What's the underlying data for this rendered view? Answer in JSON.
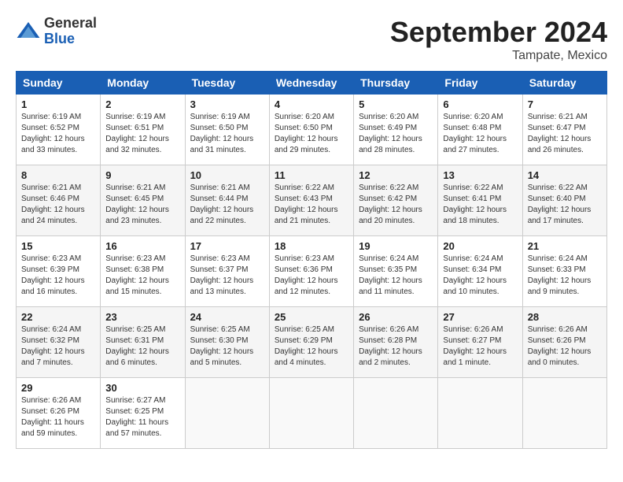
{
  "header": {
    "logo": {
      "line1": "General",
      "line2": "Blue"
    },
    "title": "September 2024",
    "location": "Tampate, Mexico"
  },
  "weekdays": [
    "Sunday",
    "Monday",
    "Tuesday",
    "Wednesday",
    "Thursday",
    "Friday",
    "Saturday"
  ],
  "weeks": [
    [
      {
        "day": "1",
        "sunrise": "Sunrise: 6:19 AM",
        "sunset": "Sunset: 6:52 PM",
        "daylight": "Daylight: 12 hours and 33 minutes."
      },
      {
        "day": "2",
        "sunrise": "Sunrise: 6:19 AM",
        "sunset": "Sunset: 6:51 PM",
        "daylight": "Daylight: 12 hours and 32 minutes."
      },
      {
        "day": "3",
        "sunrise": "Sunrise: 6:19 AM",
        "sunset": "Sunset: 6:50 PM",
        "daylight": "Daylight: 12 hours and 31 minutes."
      },
      {
        "day": "4",
        "sunrise": "Sunrise: 6:20 AM",
        "sunset": "Sunset: 6:50 PM",
        "daylight": "Daylight: 12 hours and 29 minutes."
      },
      {
        "day": "5",
        "sunrise": "Sunrise: 6:20 AM",
        "sunset": "Sunset: 6:49 PM",
        "daylight": "Daylight: 12 hours and 28 minutes."
      },
      {
        "day": "6",
        "sunrise": "Sunrise: 6:20 AM",
        "sunset": "Sunset: 6:48 PM",
        "daylight": "Daylight: 12 hours and 27 minutes."
      },
      {
        "day": "7",
        "sunrise": "Sunrise: 6:21 AM",
        "sunset": "Sunset: 6:47 PM",
        "daylight": "Daylight: 12 hours and 26 minutes."
      }
    ],
    [
      {
        "day": "8",
        "sunrise": "Sunrise: 6:21 AM",
        "sunset": "Sunset: 6:46 PM",
        "daylight": "Daylight: 12 hours and 24 minutes."
      },
      {
        "day": "9",
        "sunrise": "Sunrise: 6:21 AM",
        "sunset": "Sunset: 6:45 PM",
        "daylight": "Daylight: 12 hours and 23 minutes."
      },
      {
        "day": "10",
        "sunrise": "Sunrise: 6:21 AM",
        "sunset": "Sunset: 6:44 PM",
        "daylight": "Daylight: 12 hours and 22 minutes."
      },
      {
        "day": "11",
        "sunrise": "Sunrise: 6:22 AM",
        "sunset": "Sunset: 6:43 PM",
        "daylight": "Daylight: 12 hours and 21 minutes."
      },
      {
        "day": "12",
        "sunrise": "Sunrise: 6:22 AM",
        "sunset": "Sunset: 6:42 PM",
        "daylight": "Daylight: 12 hours and 20 minutes."
      },
      {
        "day": "13",
        "sunrise": "Sunrise: 6:22 AM",
        "sunset": "Sunset: 6:41 PM",
        "daylight": "Daylight: 12 hours and 18 minutes."
      },
      {
        "day": "14",
        "sunrise": "Sunrise: 6:22 AM",
        "sunset": "Sunset: 6:40 PM",
        "daylight": "Daylight: 12 hours and 17 minutes."
      }
    ],
    [
      {
        "day": "15",
        "sunrise": "Sunrise: 6:23 AM",
        "sunset": "Sunset: 6:39 PM",
        "daylight": "Daylight: 12 hours and 16 minutes."
      },
      {
        "day": "16",
        "sunrise": "Sunrise: 6:23 AM",
        "sunset": "Sunset: 6:38 PM",
        "daylight": "Daylight: 12 hours and 15 minutes."
      },
      {
        "day": "17",
        "sunrise": "Sunrise: 6:23 AM",
        "sunset": "Sunset: 6:37 PM",
        "daylight": "Daylight: 12 hours and 13 minutes."
      },
      {
        "day": "18",
        "sunrise": "Sunrise: 6:23 AM",
        "sunset": "Sunset: 6:36 PM",
        "daylight": "Daylight: 12 hours and 12 minutes."
      },
      {
        "day": "19",
        "sunrise": "Sunrise: 6:24 AM",
        "sunset": "Sunset: 6:35 PM",
        "daylight": "Daylight: 12 hours and 11 minutes."
      },
      {
        "day": "20",
        "sunrise": "Sunrise: 6:24 AM",
        "sunset": "Sunset: 6:34 PM",
        "daylight": "Daylight: 12 hours and 10 minutes."
      },
      {
        "day": "21",
        "sunrise": "Sunrise: 6:24 AM",
        "sunset": "Sunset: 6:33 PM",
        "daylight": "Daylight: 12 hours and 9 minutes."
      }
    ],
    [
      {
        "day": "22",
        "sunrise": "Sunrise: 6:24 AM",
        "sunset": "Sunset: 6:32 PM",
        "daylight": "Daylight: 12 hours and 7 minutes."
      },
      {
        "day": "23",
        "sunrise": "Sunrise: 6:25 AM",
        "sunset": "Sunset: 6:31 PM",
        "daylight": "Daylight: 12 hours and 6 minutes."
      },
      {
        "day": "24",
        "sunrise": "Sunrise: 6:25 AM",
        "sunset": "Sunset: 6:30 PM",
        "daylight": "Daylight: 12 hours and 5 minutes."
      },
      {
        "day": "25",
        "sunrise": "Sunrise: 6:25 AM",
        "sunset": "Sunset: 6:29 PM",
        "daylight": "Daylight: 12 hours and 4 minutes."
      },
      {
        "day": "26",
        "sunrise": "Sunrise: 6:26 AM",
        "sunset": "Sunset: 6:28 PM",
        "daylight": "Daylight: 12 hours and 2 minutes."
      },
      {
        "day": "27",
        "sunrise": "Sunrise: 6:26 AM",
        "sunset": "Sunset: 6:27 PM",
        "daylight": "Daylight: 12 hours and 1 minute."
      },
      {
        "day": "28",
        "sunrise": "Sunrise: 6:26 AM",
        "sunset": "Sunset: 6:26 PM",
        "daylight": "Daylight: 12 hours and 0 minutes."
      }
    ],
    [
      {
        "day": "29",
        "sunrise": "Sunrise: 6:26 AM",
        "sunset": "Sunset: 6:26 PM",
        "daylight": "Daylight: 11 hours and 59 minutes."
      },
      {
        "day": "30",
        "sunrise": "Sunrise: 6:27 AM",
        "sunset": "Sunset: 6:25 PM",
        "daylight": "Daylight: 11 hours and 57 minutes."
      },
      null,
      null,
      null,
      null,
      null
    ]
  ]
}
